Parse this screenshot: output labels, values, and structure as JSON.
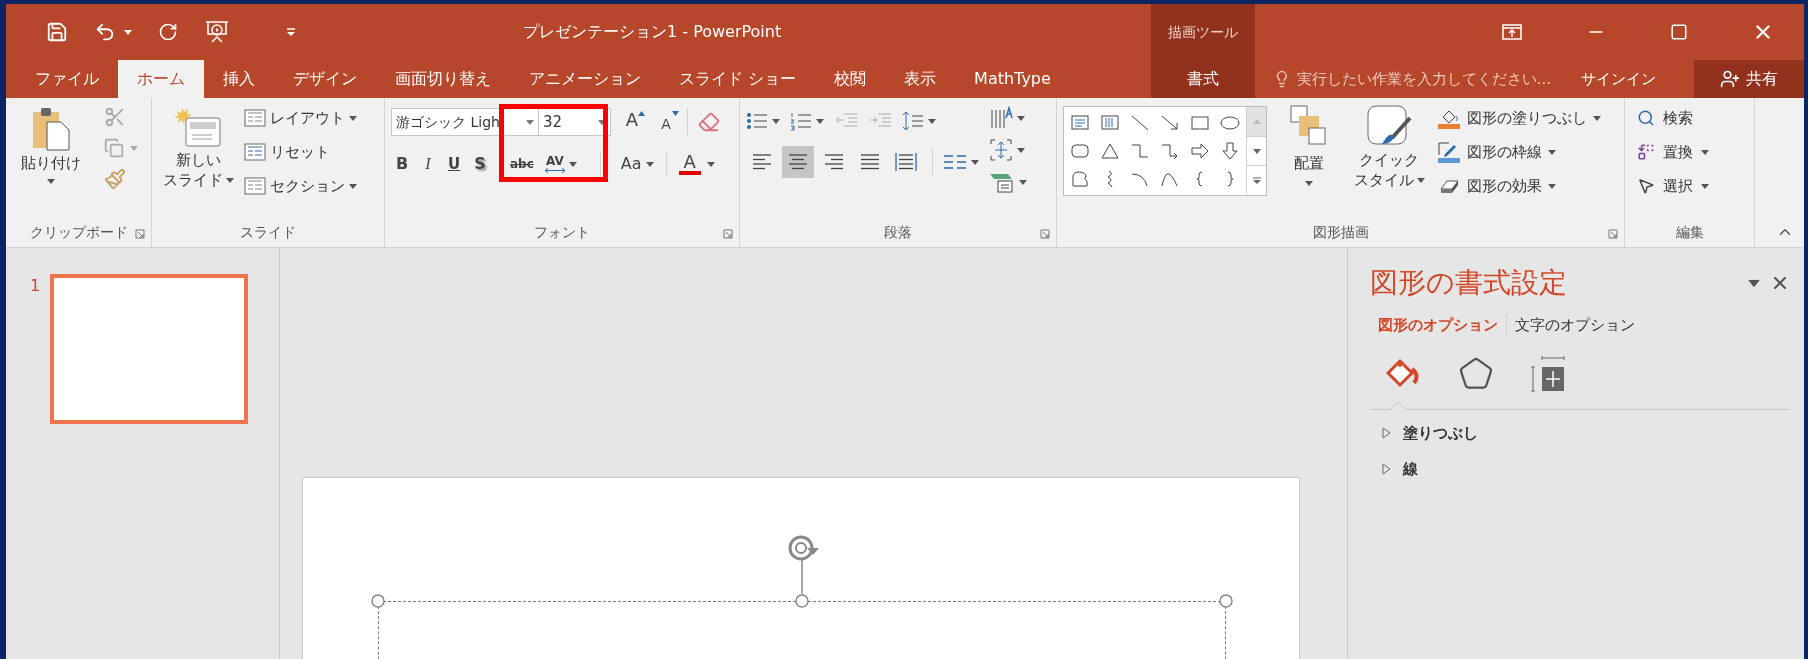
{
  "window": {
    "title": "プレゼンテーション1 - PowerPoint",
    "context_group": "描画ツール"
  },
  "tabs": [
    {
      "label": "ファイル",
      "selected": false,
      "contextual": false
    },
    {
      "label": "ホーム",
      "selected": true,
      "contextual": false
    },
    {
      "label": "挿入",
      "selected": false,
      "contextual": false
    },
    {
      "label": "デザイン",
      "selected": false,
      "contextual": false
    },
    {
      "label": "画面切り替え",
      "selected": false,
      "contextual": false
    },
    {
      "label": "アニメーション",
      "selected": false,
      "contextual": false
    },
    {
      "label": "スライド ショー",
      "selected": false,
      "contextual": false
    },
    {
      "label": "校閲",
      "selected": false,
      "contextual": false
    },
    {
      "label": "表示",
      "selected": false,
      "contextual": false
    },
    {
      "label": "MathType",
      "selected": false,
      "contextual": false
    },
    {
      "label": "書式",
      "selected": false,
      "contextual": true
    }
  ],
  "tell_me": {
    "placeholder": "実行したい作業を入力してください..."
  },
  "account": {
    "sign_in": "サインイン",
    "share": "共有"
  },
  "ribbon": {
    "clipboard": {
      "label": "クリップボード",
      "launcher": true,
      "paste": "貼り付け"
    },
    "slides": {
      "label": "スライド",
      "launcher": false,
      "new_slide": [
        "新しい",
        "スライド"
      ],
      "items": [
        {
          "label": "レイアウト",
          "dropdown": true
        },
        {
          "label": "リセット",
          "dropdown": false
        },
        {
          "label": "セクション",
          "dropdown": true
        }
      ]
    },
    "font": {
      "label": "フォント",
      "launcher": true,
      "font_name": "游ゴシック Ligh",
      "font_size": "32",
      "size_buttons": [
        {
          "kind": "grow",
          "label": "A"
        },
        {
          "kind": "shrink",
          "label": "A"
        }
      ],
      "format_buttons": [
        {
          "kind": "bold",
          "label": "B"
        },
        {
          "kind": "italic",
          "label": "I"
        },
        {
          "kind": "underline",
          "label": "U"
        },
        {
          "kind": "shadow",
          "label": "S"
        },
        {
          "kind": "strike",
          "label": "abc"
        },
        {
          "kind": "spacing",
          "label": "AV"
        }
      ],
      "case_button": "Aa",
      "color_button": "A"
    },
    "paragraph": {
      "label": "段落",
      "launcher": true,
      "alignments": [
        {
          "kind": "left",
          "selected": false
        },
        {
          "kind": "center",
          "selected": true
        },
        {
          "kind": "right",
          "selected": false
        },
        {
          "kind": "justify",
          "selected": false
        },
        {
          "kind": "distributed",
          "selected": false
        }
      ]
    },
    "drawing": {
      "label": "図形描画",
      "launcher": true,
      "arrange": "配置",
      "quick_style": [
        "クイック",
        "スタイル"
      ],
      "items": [
        {
          "kind": "fill",
          "label": "図形の塗りつぶし"
        },
        {
          "kind": "outline",
          "label": "図形の枠線"
        },
        {
          "kind": "effects",
          "label": "図形の効果"
        }
      ]
    },
    "editing": {
      "label": "編集",
      "launcher": false,
      "items": [
        {
          "kind": "find",
          "label": "検索",
          "dropdown": false
        },
        {
          "kind": "replace",
          "label": "置換",
          "dropdown": true
        },
        {
          "kind": "select",
          "label": "選択",
          "dropdown": true
        }
      ]
    }
  },
  "slides": [
    {
      "number": "1",
      "selected": true
    }
  ],
  "format_pane": {
    "title": "図形の書式設定",
    "tabs": [
      {
        "label": "図形のオプション",
        "selected": true
      },
      {
        "label": "文字のオプション",
        "selected": false
      }
    ],
    "sections": [
      {
        "label": "塗りつぶし",
        "expanded": false
      },
      {
        "label": "線",
        "expanded": false
      }
    ]
  }
}
